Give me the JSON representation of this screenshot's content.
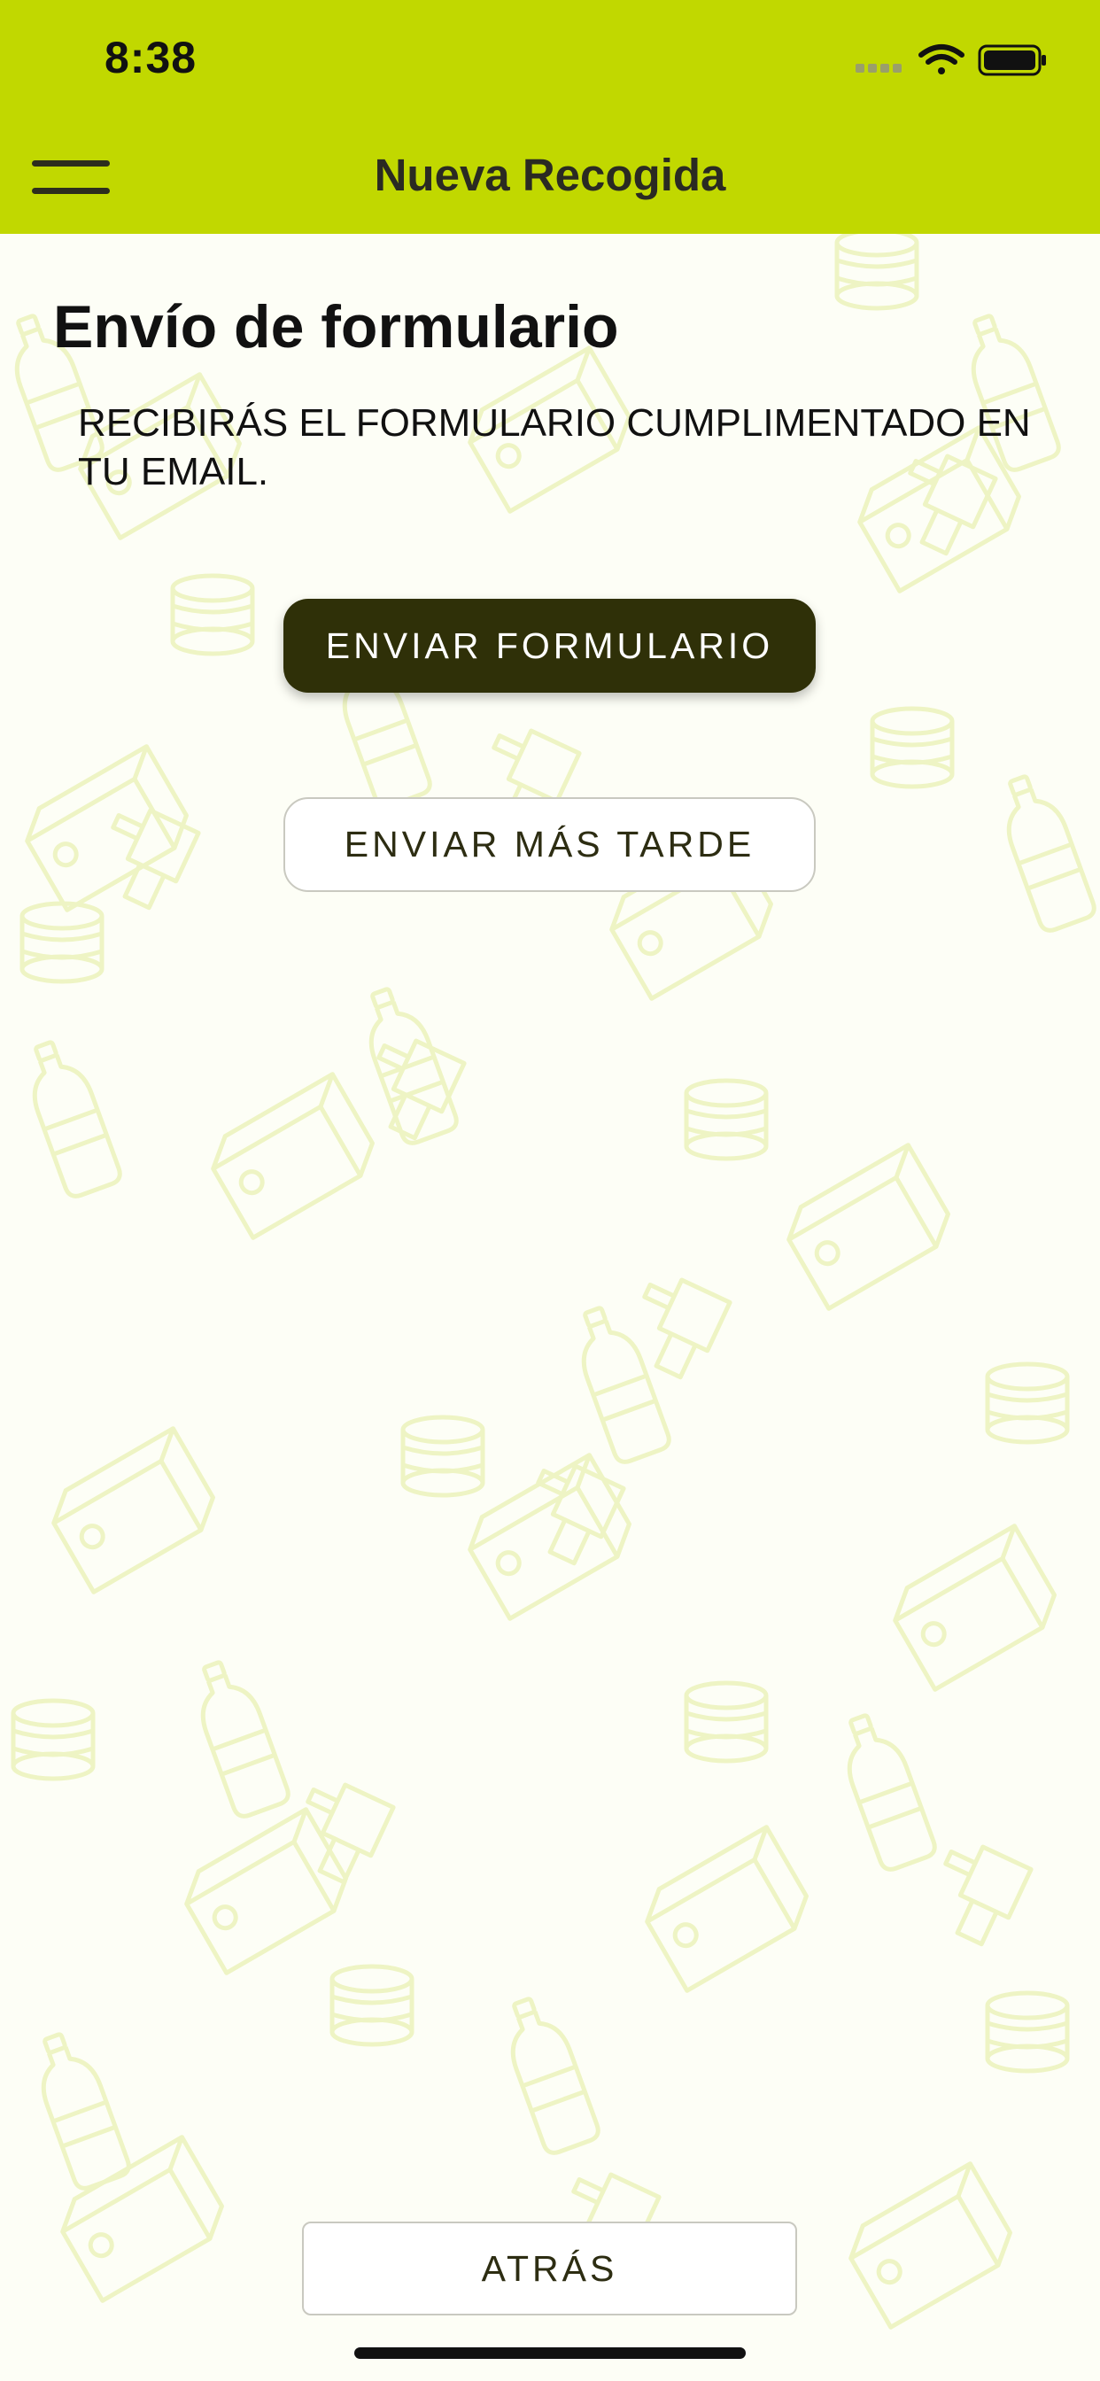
{
  "status_bar": {
    "time": "8:38"
  },
  "nav": {
    "title": "Nueva Recogida",
    "menu_icon": "hamburger-menu-icon"
  },
  "form": {
    "heading": "Envío de formulario",
    "instructions": "RECIBIRÁS EL FORMULARIO CUMPLIMENTADO EN TU EMAIL.",
    "send_button": "ENVIAR FORMULARIO",
    "send_later_button": "ENVIAR MÁS TARDE"
  },
  "footer": {
    "back_button": "ATRÁS"
  },
  "colors": {
    "header_bg": "#c1d800",
    "primary_button_bg": "#2f3008",
    "pattern_stroke": "#eef4c4",
    "content_bg": "#fdfef6"
  }
}
